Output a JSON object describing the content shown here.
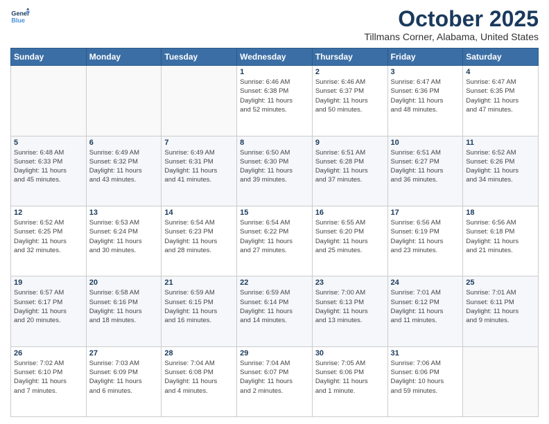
{
  "logo": {
    "line1": "General",
    "line2": "Blue"
  },
  "header": {
    "month": "October 2025",
    "location": "Tillmans Corner, Alabama, United States"
  },
  "weekdays": [
    "Sunday",
    "Monday",
    "Tuesday",
    "Wednesday",
    "Thursday",
    "Friday",
    "Saturday"
  ],
  "weeks": [
    [
      {
        "day": "",
        "info": ""
      },
      {
        "day": "",
        "info": ""
      },
      {
        "day": "",
        "info": ""
      },
      {
        "day": "1",
        "info": "Sunrise: 6:46 AM\nSunset: 6:38 PM\nDaylight: 11 hours\nand 52 minutes."
      },
      {
        "day": "2",
        "info": "Sunrise: 6:46 AM\nSunset: 6:37 PM\nDaylight: 11 hours\nand 50 minutes."
      },
      {
        "day": "3",
        "info": "Sunrise: 6:47 AM\nSunset: 6:36 PM\nDaylight: 11 hours\nand 48 minutes."
      },
      {
        "day": "4",
        "info": "Sunrise: 6:47 AM\nSunset: 6:35 PM\nDaylight: 11 hours\nand 47 minutes."
      }
    ],
    [
      {
        "day": "5",
        "info": "Sunrise: 6:48 AM\nSunset: 6:33 PM\nDaylight: 11 hours\nand 45 minutes."
      },
      {
        "day": "6",
        "info": "Sunrise: 6:49 AM\nSunset: 6:32 PM\nDaylight: 11 hours\nand 43 minutes."
      },
      {
        "day": "7",
        "info": "Sunrise: 6:49 AM\nSunset: 6:31 PM\nDaylight: 11 hours\nand 41 minutes."
      },
      {
        "day": "8",
        "info": "Sunrise: 6:50 AM\nSunset: 6:30 PM\nDaylight: 11 hours\nand 39 minutes."
      },
      {
        "day": "9",
        "info": "Sunrise: 6:51 AM\nSunset: 6:28 PM\nDaylight: 11 hours\nand 37 minutes."
      },
      {
        "day": "10",
        "info": "Sunrise: 6:51 AM\nSunset: 6:27 PM\nDaylight: 11 hours\nand 36 minutes."
      },
      {
        "day": "11",
        "info": "Sunrise: 6:52 AM\nSunset: 6:26 PM\nDaylight: 11 hours\nand 34 minutes."
      }
    ],
    [
      {
        "day": "12",
        "info": "Sunrise: 6:52 AM\nSunset: 6:25 PM\nDaylight: 11 hours\nand 32 minutes."
      },
      {
        "day": "13",
        "info": "Sunrise: 6:53 AM\nSunset: 6:24 PM\nDaylight: 11 hours\nand 30 minutes."
      },
      {
        "day": "14",
        "info": "Sunrise: 6:54 AM\nSunset: 6:23 PM\nDaylight: 11 hours\nand 28 minutes."
      },
      {
        "day": "15",
        "info": "Sunrise: 6:54 AM\nSunset: 6:22 PM\nDaylight: 11 hours\nand 27 minutes."
      },
      {
        "day": "16",
        "info": "Sunrise: 6:55 AM\nSunset: 6:20 PM\nDaylight: 11 hours\nand 25 minutes."
      },
      {
        "day": "17",
        "info": "Sunrise: 6:56 AM\nSunset: 6:19 PM\nDaylight: 11 hours\nand 23 minutes."
      },
      {
        "day": "18",
        "info": "Sunrise: 6:56 AM\nSunset: 6:18 PM\nDaylight: 11 hours\nand 21 minutes."
      }
    ],
    [
      {
        "day": "19",
        "info": "Sunrise: 6:57 AM\nSunset: 6:17 PM\nDaylight: 11 hours\nand 20 minutes."
      },
      {
        "day": "20",
        "info": "Sunrise: 6:58 AM\nSunset: 6:16 PM\nDaylight: 11 hours\nand 18 minutes."
      },
      {
        "day": "21",
        "info": "Sunrise: 6:59 AM\nSunset: 6:15 PM\nDaylight: 11 hours\nand 16 minutes."
      },
      {
        "day": "22",
        "info": "Sunrise: 6:59 AM\nSunset: 6:14 PM\nDaylight: 11 hours\nand 14 minutes."
      },
      {
        "day": "23",
        "info": "Sunrise: 7:00 AM\nSunset: 6:13 PM\nDaylight: 11 hours\nand 13 minutes."
      },
      {
        "day": "24",
        "info": "Sunrise: 7:01 AM\nSunset: 6:12 PM\nDaylight: 11 hours\nand 11 minutes."
      },
      {
        "day": "25",
        "info": "Sunrise: 7:01 AM\nSunset: 6:11 PM\nDaylight: 11 hours\nand 9 minutes."
      }
    ],
    [
      {
        "day": "26",
        "info": "Sunrise: 7:02 AM\nSunset: 6:10 PM\nDaylight: 11 hours\nand 7 minutes."
      },
      {
        "day": "27",
        "info": "Sunrise: 7:03 AM\nSunset: 6:09 PM\nDaylight: 11 hours\nand 6 minutes."
      },
      {
        "day": "28",
        "info": "Sunrise: 7:04 AM\nSunset: 6:08 PM\nDaylight: 11 hours\nand 4 minutes."
      },
      {
        "day": "29",
        "info": "Sunrise: 7:04 AM\nSunset: 6:07 PM\nDaylight: 11 hours\nand 2 minutes."
      },
      {
        "day": "30",
        "info": "Sunrise: 7:05 AM\nSunset: 6:06 PM\nDaylight: 11 hours\nand 1 minute."
      },
      {
        "day": "31",
        "info": "Sunrise: 7:06 AM\nSunset: 6:06 PM\nDaylight: 10 hours\nand 59 minutes."
      },
      {
        "day": "",
        "info": ""
      }
    ]
  ]
}
